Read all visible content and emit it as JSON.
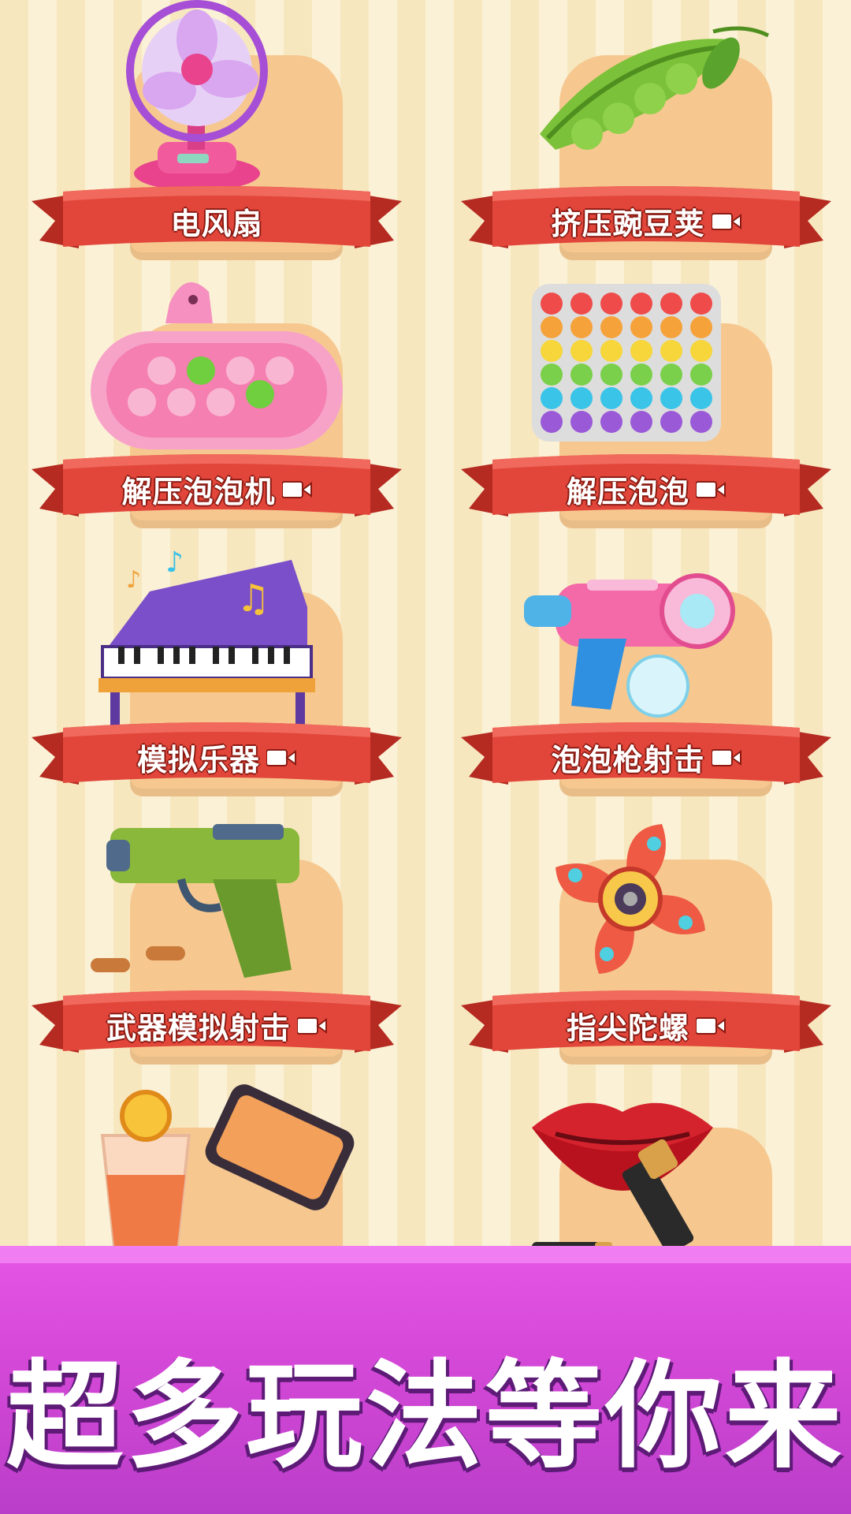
{
  "items": [
    {
      "label": "电风扇",
      "icon": "desk-fan-icon",
      "has_video": false
    },
    {
      "label": "挤压豌豆荚",
      "icon": "pea-pod-icon",
      "has_video": true
    },
    {
      "label": "解压泡泡机",
      "icon": "pop-it-gamepad-icon",
      "has_video": true
    },
    {
      "label": "解压泡泡",
      "icon": "rainbow-pop-it-icon",
      "has_video": true
    },
    {
      "label": "模拟乐器",
      "icon": "piano-icon",
      "has_video": true
    },
    {
      "label": "泡泡枪射击",
      "icon": "bubble-gun-icon",
      "has_video": true
    },
    {
      "label": "武器模拟射击",
      "icon": "toy-pistol-icon",
      "has_video": true
    },
    {
      "label": "指尖陀螺",
      "icon": "fidget-spinner-icon",
      "has_video": true
    },
    {
      "label": "",
      "icon": "juice-phone-icon",
      "has_video": false
    },
    {
      "label": "",
      "icon": "lipstick-lips-icon",
      "has_video": false
    }
  ],
  "banner": {
    "text": "超多玩法等你来"
  },
  "colors": {
    "ribbon": "#e2463a",
    "ribbon_dark": "#b52a21",
    "pedestal": "#f6c890",
    "banner": "#d649d8"
  }
}
